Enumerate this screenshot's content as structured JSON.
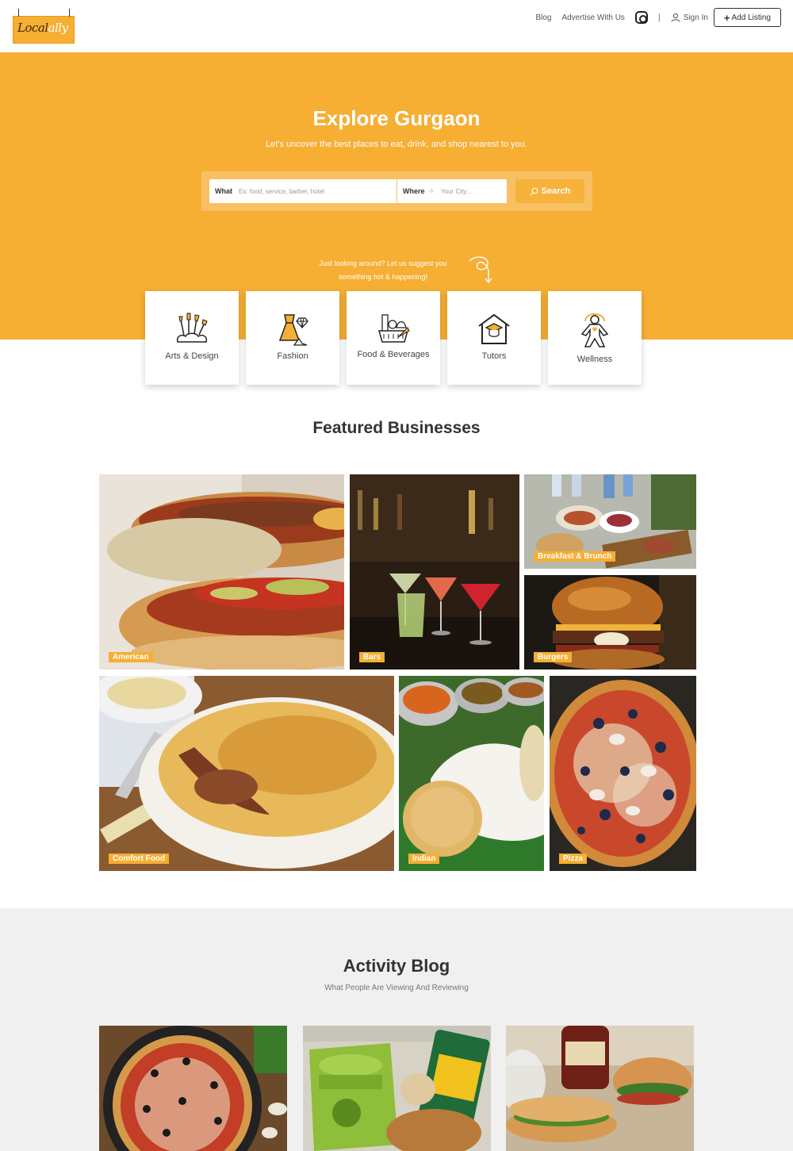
{
  "header": {
    "logo_text_a": "Local",
    "logo_text_b": "ally",
    "nav": {
      "blog": "Blog",
      "advertise": "Advertise With Us",
      "separator": "|",
      "sign_in": "Sign In",
      "add_listing": "Add Listing"
    }
  },
  "hero": {
    "title": "Explore Gurgaon",
    "subtitle": "Let's uncover the best places to eat, drink, and shop nearest to you.",
    "search": {
      "what_label": "What",
      "what_placeholder": "Ex: food, service, barber, hotel",
      "where_label": "Where",
      "where_placeholder": "Your City...",
      "button": "Search"
    },
    "suggest_line1": "Just looking around? Let us suggest you",
    "suggest_line2": "something hot & happening!",
    "accent_color": "#f6ae33"
  },
  "categories": [
    {
      "label": "Arts & Design",
      "icon": "brushes-icon"
    },
    {
      "label": "Fashion",
      "icon": "dress-icon"
    },
    {
      "label": "Food & Beverages",
      "icon": "grocery-basket-icon"
    },
    {
      "label": "Tutors",
      "icon": "school-house-icon"
    },
    {
      "label": "Wellness",
      "icon": "person-wellness-icon"
    }
  ],
  "featured": {
    "title": "Featured Businesses",
    "tiles": [
      {
        "label": "American"
      },
      {
        "label": "Bars"
      },
      {
        "label": "Breakfast & Brunch"
      },
      {
        "label": "Burgers"
      },
      {
        "label": "Comfort Food"
      },
      {
        "label": "Indian"
      },
      {
        "label": "Pizza"
      }
    ]
  },
  "blog": {
    "title": "Activity Blog",
    "subtitle": "What People Are Viewing And Reviewing"
  }
}
